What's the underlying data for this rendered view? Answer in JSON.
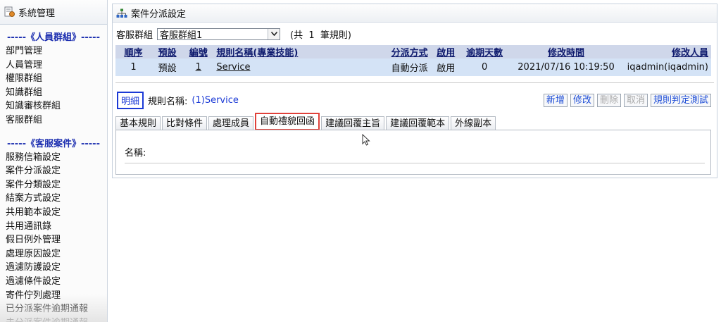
{
  "sidebar": {
    "title": "系統管理",
    "group1_title": "-----《人員群組》-----",
    "group1_items": [
      "部門管理",
      "人員管理",
      "權限群組",
      "知識群組",
      "知識審核群組",
      "客服群組"
    ],
    "group2_title": "-----《客服案件》-----",
    "group2_items": [
      "服務信箱設定",
      "案件分派設定",
      "案件分類設定",
      "結案方式設定",
      "共用範本設定",
      "共用通訊錄",
      "假日例外管理",
      "處理原因設定",
      "過濾防護設定",
      "過濾條件設定",
      "寄件佇列處理",
      "已分派案件逾期通報",
      "未分派案件逾期通報"
    ]
  },
  "main": {
    "title": "案件分派設定",
    "group_label": "客服群組",
    "group_selected": "客服群組1",
    "rule_count_prefix": "(共",
    "rule_count": "1",
    "rule_count_suffix": "筆規則)",
    "table": {
      "headers": [
        "順序",
        "預設",
        "編號",
        "規則名稱(專業技能)",
        "分派方式",
        "啟用",
        "逾期天數",
        "修改時間",
        "修改人員"
      ],
      "rows": [
        [
          "1",
          "預設",
          "1",
          "Service",
          "自動分派",
          "啟用",
          "0",
          "2021/07/16 10:19:50",
          "iqadmin(iqadmin)"
        ]
      ]
    },
    "detail_button": "明細",
    "rule_name_label": "規則名稱:",
    "rule_name_value": "(1)Service",
    "actions": {
      "add": "新增",
      "edit": "修改",
      "delete": "刪除",
      "cancel": "取消",
      "test": "規則判定測試"
    },
    "tabs": [
      "基本規則",
      "比對條件",
      "處理成員",
      "自動禮貌回函",
      "建議回覆主旨",
      "建議回覆範本",
      "外線副本"
    ],
    "active_tab": "自動禮貌回函",
    "name_field_label": "名稱:"
  }
}
